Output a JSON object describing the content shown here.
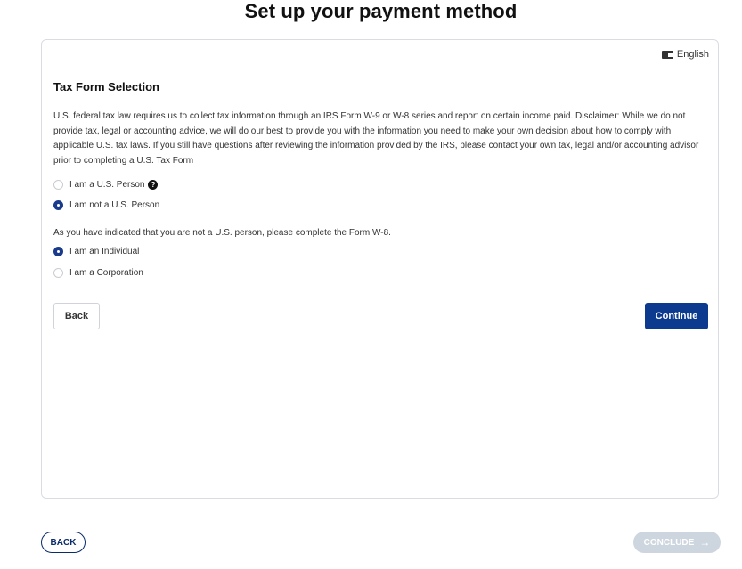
{
  "page": {
    "title": "Set up your payment method"
  },
  "card": {
    "language": {
      "icon": "language-card-icon",
      "label": "English"
    },
    "section_title": "Tax Form Selection",
    "disclaimer": "U.S. federal tax law requires us to collect tax information through an IRS Form W-9 or W-8 series and report on certain income paid. Disclaimer: While we do not provide tax, legal or accounting advice, we will do our best to provide you with the information you need to make your own decision about how to comply with applicable U.S. tax laws. If you still have questions after reviewing the information provided by the IRS, please contact your own tax, legal and/or accounting advisor prior to completing a U.S. Tax Form",
    "person_options": [
      {
        "label": "I am a U.S. Person",
        "checked": false,
        "has_help": true
      },
      {
        "label": "I am not a U.S. Person",
        "checked": true
      }
    ],
    "notice": "As you have indicated that you are not a U.S. person, please complete the Form W-8.",
    "entity_options": [
      {
        "label": "I am an Individual",
        "checked": true
      },
      {
        "label": "I am a Corporation",
        "checked": false
      }
    ],
    "help_glyph": "?",
    "back_label": "Back",
    "continue_label": "Continue"
  },
  "footer": {
    "back_label": "BACK",
    "conclude_label": "CONCLUDE",
    "conclude_arrow": "→",
    "conclude_disabled": true
  },
  "colors": {
    "primary": "#0b3a8f",
    "footer_outline": "#0b2b6b",
    "disabled": "#cdd6df",
    "border": "#d9dde3"
  }
}
